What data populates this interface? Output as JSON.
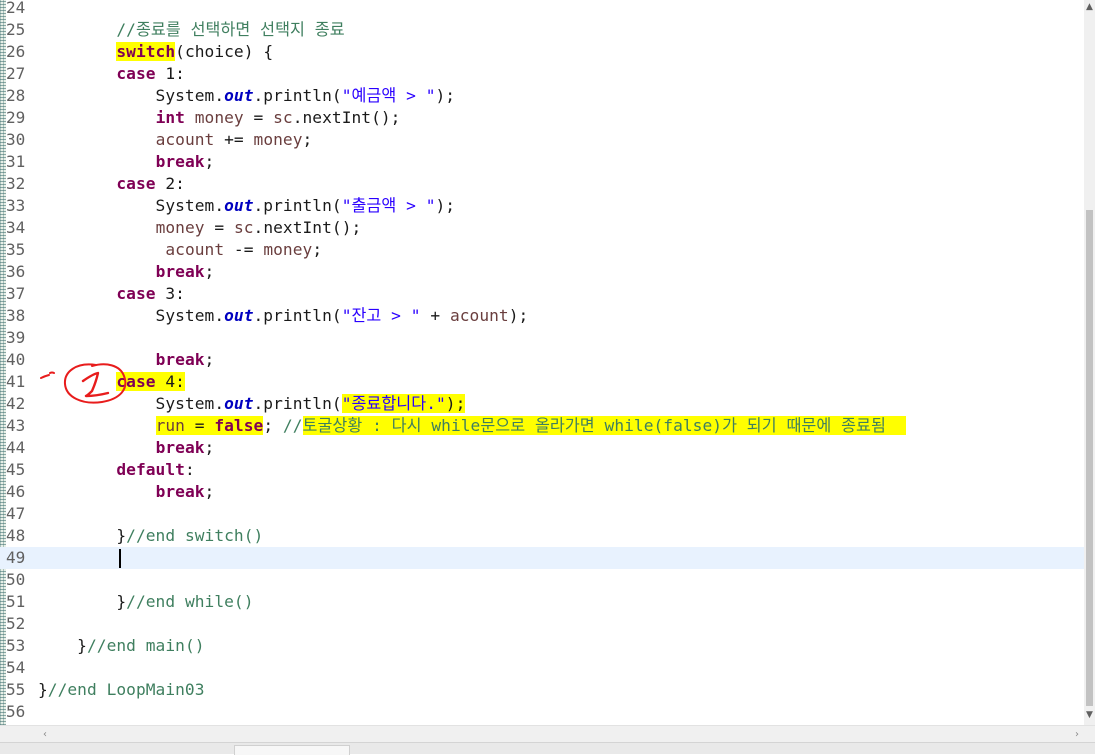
{
  "editor": {
    "current_line": 49,
    "lines": [
      {
        "n": "24",
        "seg": []
      },
      {
        "n": "25",
        "seg": [
          {
            "t": "        "
          },
          {
            "t": "//종료를 선택하면 선택지 종료",
            "c": "cmt"
          }
        ]
      },
      {
        "n": "26",
        "seg": [
          {
            "t": "        "
          },
          {
            "t": "switch",
            "c": "kw hl"
          },
          {
            "t": "(choice) {"
          }
        ]
      },
      {
        "n": "27",
        "seg": [
          {
            "t": "        "
          },
          {
            "t": "case",
            "c": "kw"
          },
          {
            "t": " 1:"
          }
        ]
      },
      {
        "n": "28",
        "seg": [
          {
            "t": "            System."
          },
          {
            "t": "out",
            "c": "fld"
          },
          {
            "t": ".println("
          },
          {
            "t": "\"예금액 > \"",
            "c": "str"
          },
          {
            "t": ");"
          }
        ]
      },
      {
        "n": "29",
        "seg": [
          {
            "t": "            "
          },
          {
            "t": "int",
            "c": "kw"
          },
          {
            "t": " "
          },
          {
            "t": "money",
            "c": "var"
          },
          {
            "t": " = "
          },
          {
            "t": "sc",
            "c": "var"
          },
          {
            "t": ".nextInt();"
          }
        ]
      },
      {
        "n": "30",
        "seg": [
          {
            "t": "            "
          },
          {
            "t": "acount",
            "c": "var"
          },
          {
            "t": " += "
          },
          {
            "t": "money",
            "c": "var"
          },
          {
            "t": ";"
          }
        ]
      },
      {
        "n": "31",
        "seg": [
          {
            "t": "            "
          },
          {
            "t": "break",
            "c": "kw"
          },
          {
            "t": ";"
          }
        ]
      },
      {
        "n": "32",
        "seg": [
          {
            "t": "        "
          },
          {
            "t": "case",
            "c": "kw"
          },
          {
            "t": " 2:"
          }
        ]
      },
      {
        "n": "33",
        "seg": [
          {
            "t": "            System."
          },
          {
            "t": "out",
            "c": "fld"
          },
          {
            "t": ".println("
          },
          {
            "t": "\"출금액 > \"",
            "c": "str"
          },
          {
            "t": ");"
          }
        ]
      },
      {
        "n": "34",
        "seg": [
          {
            "t": "            "
          },
          {
            "t": "money",
            "c": "var"
          },
          {
            "t": " = "
          },
          {
            "t": "sc",
            "c": "var"
          },
          {
            "t": ".nextInt();"
          }
        ]
      },
      {
        "n": "35",
        "seg": [
          {
            "t": "             "
          },
          {
            "t": "acount",
            "c": "var"
          },
          {
            "t": " -= "
          },
          {
            "t": "money",
            "c": "var"
          },
          {
            "t": ";"
          }
        ]
      },
      {
        "n": "36",
        "seg": [
          {
            "t": "            "
          },
          {
            "t": "break",
            "c": "kw"
          },
          {
            "t": ";"
          }
        ]
      },
      {
        "n": "37",
        "seg": [
          {
            "t": "        "
          },
          {
            "t": "case",
            "c": "kw"
          },
          {
            "t": " 3:"
          }
        ]
      },
      {
        "n": "38",
        "seg": [
          {
            "t": "            System."
          },
          {
            "t": "out",
            "c": "fld"
          },
          {
            "t": ".println("
          },
          {
            "t": "\"잔고 > \"",
            "c": "str"
          },
          {
            "t": " + "
          },
          {
            "t": "acount",
            "c": "var"
          },
          {
            "t": ");"
          }
        ]
      },
      {
        "n": "39",
        "seg": []
      },
      {
        "n": "40",
        "seg": [
          {
            "t": "            "
          },
          {
            "t": "break",
            "c": "kw"
          },
          {
            "t": ";"
          }
        ]
      },
      {
        "n": "41",
        "seg": [
          {
            "t": "        "
          },
          {
            "t": "case",
            "c": "kw hl"
          },
          {
            "t": " 4:",
            "c": "hl"
          }
        ]
      },
      {
        "n": "42",
        "seg": [
          {
            "t": "            System."
          },
          {
            "t": "out",
            "c": "fld"
          },
          {
            "t": ".println("
          },
          {
            "t": "\"종료합니다.\"",
            "c": "str hl"
          },
          {
            "t": ");",
            "c": "hl"
          }
        ]
      },
      {
        "n": "43",
        "seg": [
          {
            "t": "            "
          },
          {
            "t": "run",
            "c": "var hl"
          },
          {
            "t": " = ",
            "c": "hl"
          },
          {
            "t": "false",
            "c": "kw hl"
          },
          {
            "t": "; "
          },
          {
            "t": "//",
            "c": "cmt"
          },
          {
            "t": "토굴상황 : 다시 while문으로 올라가면 while(false)가 되기 때문에 종료됨  ",
            "c": "cmt hl"
          }
        ]
      },
      {
        "n": "44",
        "seg": [
          {
            "t": "            "
          },
          {
            "t": "break",
            "c": "kw"
          },
          {
            "t": ";"
          }
        ]
      },
      {
        "n": "45",
        "seg": [
          {
            "t": "        "
          },
          {
            "t": "default",
            "c": "kw"
          },
          {
            "t": ":"
          }
        ]
      },
      {
        "n": "46",
        "seg": [
          {
            "t": "            "
          },
          {
            "t": "break",
            "c": "kw"
          },
          {
            "t": ";"
          }
        ]
      },
      {
        "n": "47",
        "seg": []
      },
      {
        "n": "48",
        "seg": [
          {
            "t": "        }"
          },
          {
            "t": "//end switch()",
            "c": "cmt"
          }
        ]
      },
      {
        "n": "49",
        "seg": []
      },
      {
        "n": "50",
        "seg": []
      },
      {
        "n": "51",
        "seg": [
          {
            "t": "        }"
          },
          {
            "t": "//end while()",
            "c": "cmt"
          }
        ]
      },
      {
        "n": "52",
        "seg": []
      },
      {
        "n": "53",
        "seg": [
          {
            "t": "    }"
          },
          {
            "t": "//end main()",
            "c": "cmt"
          }
        ]
      },
      {
        "n": "54",
        "seg": []
      },
      {
        "n": "55",
        "seg": [
          {
            "t": "}"
          },
          {
            "t": "//end LoopMain03",
            "c": "cmt"
          }
        ]
      },
      {
        "n": "56",
        "seg": []
      }
    ]
  },
  "annotation": {
    "label": "1",
    "color": "#e81c1c"
  },
  "colors": {
    "keyword": "#7f0055",
    "field": "#0000c0",
    "string": "#2a00ff",
    "comment": "#3f7f5f",
    "variable": "#6a3e3e",
    "highlight": "#ffff00",
    "current_line": "#e8f2fe"
  },
  "scrollbar": {
    "up_icon": "▲",
    "down_icon": "▼",
    "left_icon": "‹",
    "right_icon": "›"
  }
}
